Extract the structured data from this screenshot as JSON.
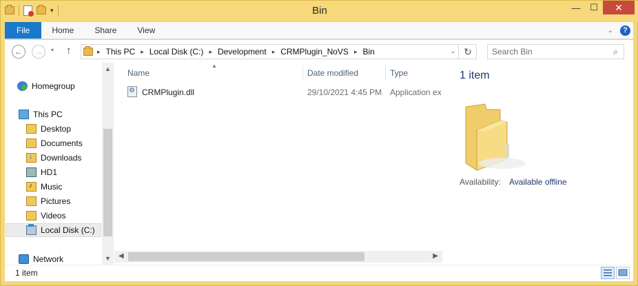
{
  "window": {
    "title": "Bin",
    "minimize_glyph": "—",
    "maximize_glyph": "☐",
    "close_glyph": "✕"
  },
  "ribbon": {
    "tabs": [
      {
        "label": "File"
      },
      {
        "label": "Home"
      },
      {
        "label": "Share"
      },
      {
        "label": "View"
      }
    ],
    "help_glyph": "?",
    "expand_glyph": "⌄"
  },
  "navigation": {
    "back_glyph": "←",
    "forward_glyph": "→",
    "up_glyph": "↑",
    "refresh_glyph": "↻",
    "breadcrumb": [
      "This PC",
      "Local Disk (C:)",
      "Development",
      "CRMPlugin_NoVS",
      "Bin"
    ],
    "search_placeholder": "Search Bin",
    "search_icon": "magnifier-icon"
  },
  "sidebar": {
    "items": [
      {
        "label": "Homegroup",
        "icon": "homegroup-icon"
      },
      {
        "label": "This PC",
        "icon": "computer-icon"
      },
      {
        "label": "Desktop",
        "icon": "folder-icon"
      },
      {
        "label": "Documents",
        "icon": "folder-icon"
      },
      {
        "label": "Downloads",
        "icon": "downloads-folder-icon"
      },
      {
        "label": "HD1",
        "icon": "drive-icon"
      },
      {
        "label": "Music",
        "icon": "music-folder-icon"
      },
      {
        "label": "Pictures",
        "icon": "folder-icon"
      },
      {
        "label": "Videos",
        "icon": "folder-icon"
      },
      {
        "label": "Local Disk (C:)",
        "icon": "local-disk-icon",
        "selected": true
      },
      {
        "label": "Network",
        "icon": "network-icon"
      }
    ]
  },
  "file_list": {
    "columns": [
      "Name",
      "Date modified",
      "Type"
    ],
    "rows": [
      {
        "name": "CRMPlugin.dll",
        "date_modified": "29/10/2021 4:45 PM",
        "type": "Application ex"
      }
    ]
  },
  "details_pane": {
    "count": "1 item",
    "availability_label": "Availability:",
    "availability_value": "Available offline"
  },
  "status_bar": {
    "text": "1 item"
  },
  "colors": {
    "frame": "#f5d77a",
    "file_tab": "#1979ca",
    "close_button": "#c74a3a",
    "accent_text": "#1e3a6a"
  }
}
